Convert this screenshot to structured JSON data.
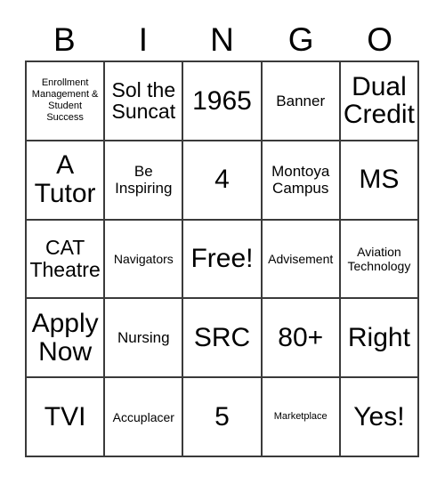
{
  "header": {
    "letters": [
      "B",
      "I",
      "N",
      "G",
      "O"
    ]
  },
  "grid": {
    "rows": [
      [
        {
          "text": "Enrollment Management & Student Success",
          "size": "fs-xs"
        },
        {
          "text": "Sol the Suncat",
          "size": "fs-lg"
        },
        {
          "text": "1965",
          "size": "fs-xl"
        },
        {
          "text": "Banner",
          "size": "fs-md"
        },
        {
          "text": "Dual Credit",
          "size": "fs-xl"
        }
      ],
      [
        {
          "text": "A Tutor",
          "size": "fs-xl"
        },
        {
          "text": "Be Inspiring",
          "size": "fs-md"
        },
        {
          "text": "4",
          "size": "fs-xl"
        },
        {
          "text": "Montoya Campus",
          "size": "fs-md"
        },
        {
          "text": "MS",
          "size": "fs-xl"
        }
      ],
      [
        {
          "text": "CAT Theatre",
          "size": "fs-lg"
        },
        {
          "text": "Navigators",
          "size": "fs-sm"
        },
        {
          "text": "Free!",
          "size": "fs-xl"
        },
        {
          "text": "Advisement",
          "size": "fs-sm"
        },
        {
          "text": "Aviation Technology",
          "size": "fs-sm"
        }
      ],
      [
        {
          "text": "Apply Now",
          "size": "fs-xl"
        },
        {
          "text": "Nursing",
          "size": "fs-md"
        },
        {
          "text": "SRC",
          "size": "fs-xl"
        },
        {
          "text": "80+",
          "size": "fs-xl"
        },
        {
          "text": "Right",
          "size": "fs-xl"
        }
      ],
      [
        {
          "text": "TVI",
          "size": "fs-xl"
        },
        {
          "text": "Accuplacer",
          "size": "fs-sm"
        },
        {
          "text": "5",
          "size": "fs-xl"
        },
        {
          "text": "Marketplace",
          "size": "fs-xs"
        },
        {
          "text": "Yes!",
          "size": "fs-xl"
        }
      ]
    ]
  },
  "colors": {
    "border": "#3a3a3a",
    "text": "#000000",
    "background": "#ffffff"
  }
}
